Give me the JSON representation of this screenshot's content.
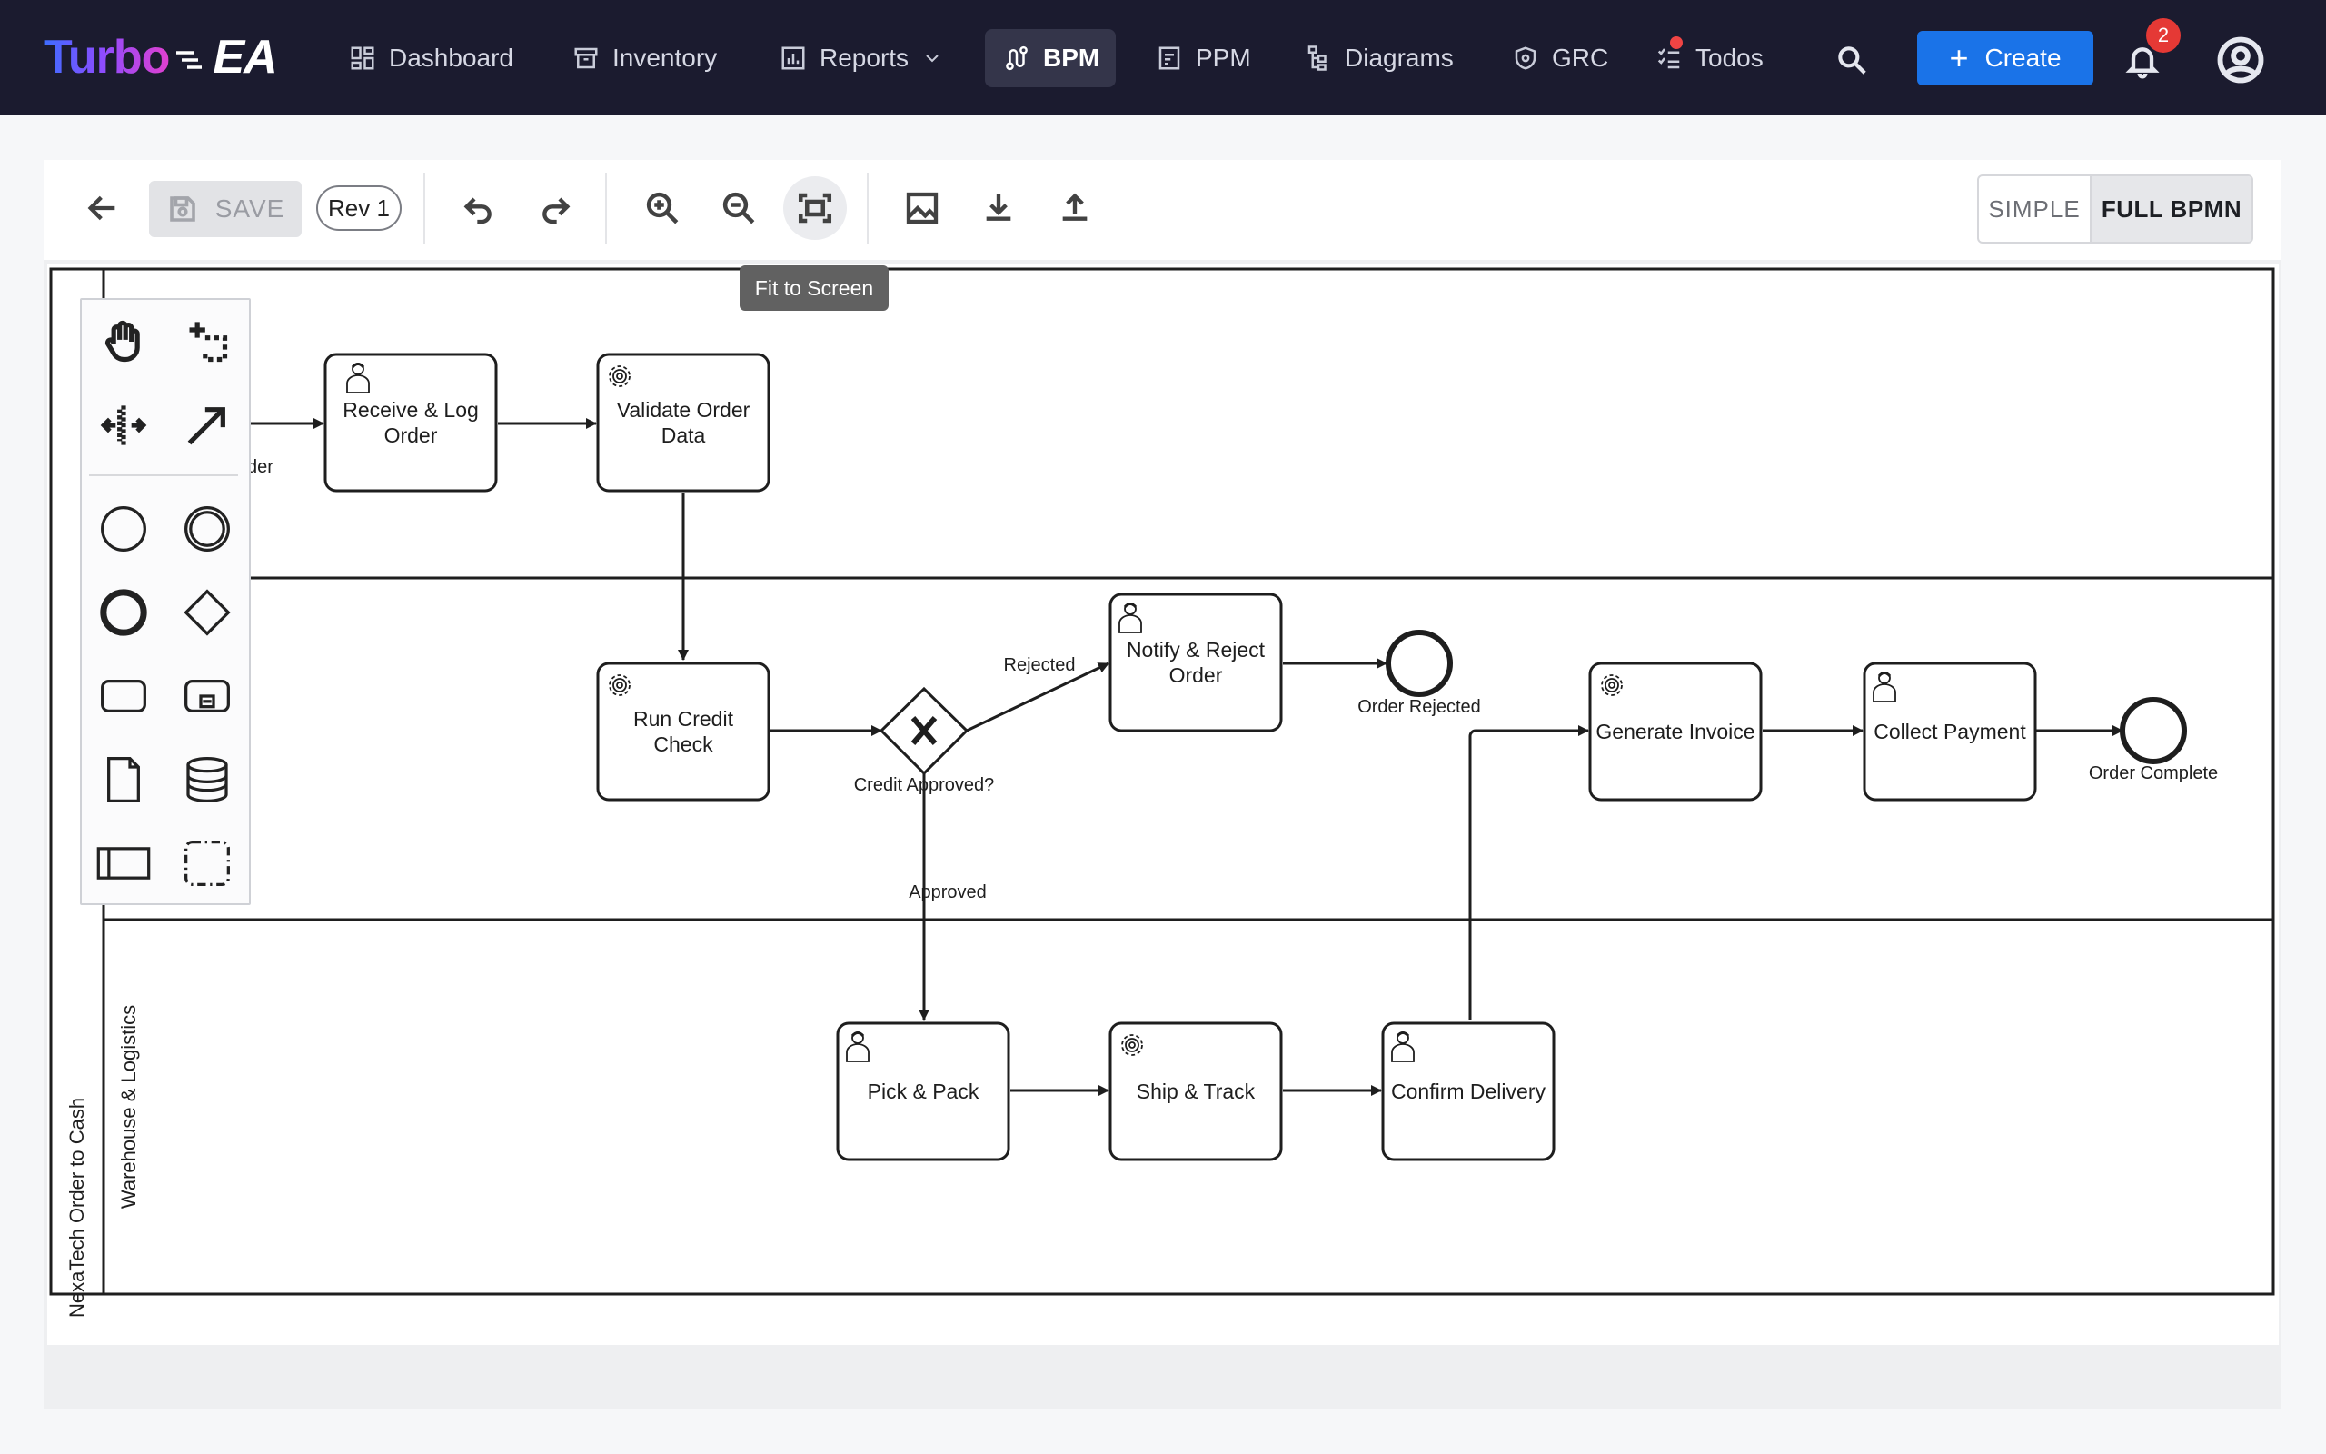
{
  "app": {
    "logo_turbo": "Turbo",
    "logo_ea": "EA"
  },
  "nav": {
    "dashboard": "Dashboard",
    "inventory": "Inventory",
    "reports": "Reports",
    "bpm": "BPM",
    "ppm": "PPM",
    "diagrams": "Diagrams",
    "grc": "GRC",
    "todos": "Todos",
    "create": "Create",
    "notification_count": "2",
    "active_item": "BPM"
  },
  "toolbar": {
    "save_label": "SAVE",
    "revision": "Rev 1",
    "tooltip": "Fit to Screen",
    "mode_simple": "SIMPLE",
    "mode_full": "FULL BPMN",
    "active_mode": "FULL BPMN"
  },
  "diagram": {
    "pool_name": "NexaTech Order to Cash",
    "lanes": {
      "lane3": "Warehouse & Logistics"
    },
    "partial_flow_label": "der",
    "tasks": {
      "receive_log": "Receive & Log Order",
      "validate_order": "Validate Order Data",
      "run_credit": "Run Credit Check",
      "notify_reject": "Notify & Reject Order",
      "generate_invoice": "Generate Invoice",
      "collect_payment": "Collect Payment",
      "pick_pack": "Pick & Pack",
      "ship_track": "Ship & Track",
      "confirm_delivery": "Confirm Delivery"
    },
    "gateway_label": "Credit Approved?",
    "flow_labels": {
      "rejected": "Rejected",
      "approved": "Approved"
    },
    "end_events": {
      "order_rejected": "Order Rejected",
      "order_complete": "Order Complete"
    }
  },
  "colors": {
    "nav_bg": "#1b1b2f",
    "create_button": "#1a73e8",
    "badge": "#e53935"
  }
}
